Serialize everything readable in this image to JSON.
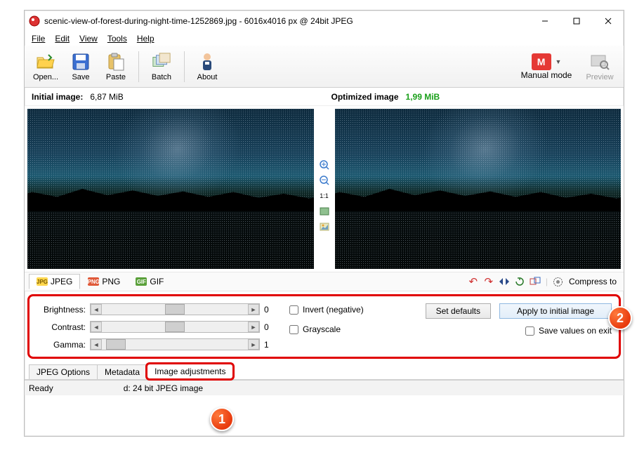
{
  "title": "scenic-view-of-forest-during-night-time-1252869.jpg - 6016x4016 px @ 24bit JPEG",
  "menu": {
    "file": "File",
    "edit": "Edit",
    "view": "View",
    "tools": "Tools",
    "help": "Help"
  },
  "toolbar": {
    "open": "Open...",
    "save": "Save",
    "paste": "Paste",
    "batch": "Batch",
    "about": "About",
    "manual": "Manual mode",
    "manual_letter": "M",
    "preview": "Preview"
  },
  "info": {
    "initial_label": "Initial image:",
    "initial_size": "6,87 MiB",
    "optimized_label": "Optimized image",
    "optimized_size": "1,99 MiB"
  },
  "center_tools": {
    "ratio": "1:1"
  },
  "formats": {
    "jpeg": "JPEG",
    "png": "PNG",
    "gif": "GIF"
  },
  "actions": {
    "compress": "Compress to"
  },
  "adjust": {
    "brightness_label": "Brightness:",
    "brightness_val": "0",
    "contrast_label": "Contrast:",
    "contrast_val": "0",
    "gamma_label": "Gamma:",
    "gamma_val": "1",
    "invert": "Invert (negative)",
    "grayscale": "Grayscale",
    "set_defaults": "Set defaults",
    "apply": "Apply to initial image",
    "save_on_exit": "Save values on exit"
  },
  "tabs": {
    "jpeg_opts": "JPEG Options",
    "metadata": "Metadata",
    "image_adj": "Image adjustments"
  },
  "status": {
    "ready": "Ready",
    "detail": "d: 24 bit JPEG image"
  },
  "badges": {
    "one": "1",
    "two": "2"
  }
}
